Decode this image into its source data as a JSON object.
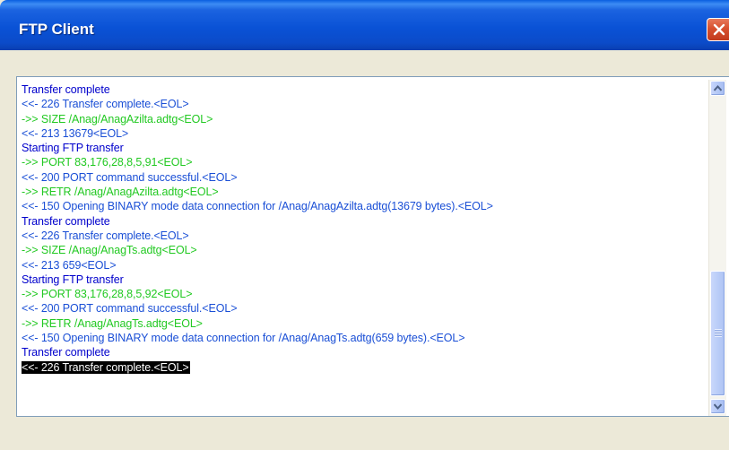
{
  "window": {
    "title": "FTP Client"
  },
  "colors": {
    "status": "#0000cc",
    "reply": "#1a4fd6",
    "command": "#22c922",
    "selected_bg": "#000000",
    "selected_fg": "#ffffff"
  },
  "log": {
    "lines": [
      {
        "text": "Transfer complete",
        "kind": "status",
        "selected": false
      },
      {
        "text": "<<- 226 Transfer complete.<EOL>",
        "kind": "reply",
        "selected": false
      },
      {
        "text": "->> SIZE /Anag/AnagAzilta.adtg<EOL>",
        "kind": "command",
        "selected": false
      },
      {
        "text": "<<- 213 13679<EOL>",
        "kind": "reply",
        "selected": false
      },
      {
        "text": "Starting FTP transfer",
        "kind": "status",
        "selected": false
      },
      {
        "text": "->> PORT 83,176,28,8,5,91<EOL>",
        "kind": "command",
        "selected": false
      },
      {
        "text": "<<- 200 PORT command successful.<EOL>",
        "kind": "reply",
        "selected": false
      },
      {
        "text": "->> RETR /Anag/AnagAzilta.adtg<EOL>",
        "kind": "command",
        "selected": false
      },
      {
        "text": "<<- 150 Opening BINARY mode data connection for /Anag/AnagAzilta.adtg(13679 bytes).<EOL>",
        "kind": "reply",
        "selected": false
      },
      {
        "text": "Transfer complete",
        "kind": "status",
        "selected": false
      },
      {
        "text": "<<- 226 Transfer complete.<EOL>",
        "kind": "reply",
        "selected": false
      },
      {
        "text": "->> SIZE /Anag/AnagTs.adtg<EOL>",
        "kind": "command",
        "selected": false
      },
      {
        "text": "<<- 213 659<EOL>",
        "kind": "reply",
        "selected": false
      },
      {
        "text": "Starting FTP transfer",
        "kind": "status",
        "selected": false
      },
      {
        "text": "->> PORT 83,176,28,8,5,92<EOL>",
        "kind": "command",
        "selected": false
      },
      {
        "text": "<<- 200 PORT command successful.<EOL>",
        "kind": "reply",
        "selected": false
      },
      {
        "text": "->> RETR /Anag/AnagTs.adtg<EOL>",
        "kind": "command",
        "selected": false
      },
      {
        "text": "<<- 150 Opening BINARY mode data connection for /Anag/AnagTs.adtg(659 bytes).<EOL>",
        "kind": "reply",
        "selected": false
      },
      {
        "text": "Transfer complete",
        "kind": "status",
        "selected": false
      },
      {
        "text": "<<- 226 Transfer complete.<EOL>",
        "kind": "reply",
        "selected": true
      }
    ]
  },
  "scrollbar": {
    "position": 0.62,
    "up_icon": "scroll-up-arrow-icon",
    "down_icon": "scroll-down-arrow-icon"
  },
  "icons": {
    "close": "close-x-icon"
  }
}
